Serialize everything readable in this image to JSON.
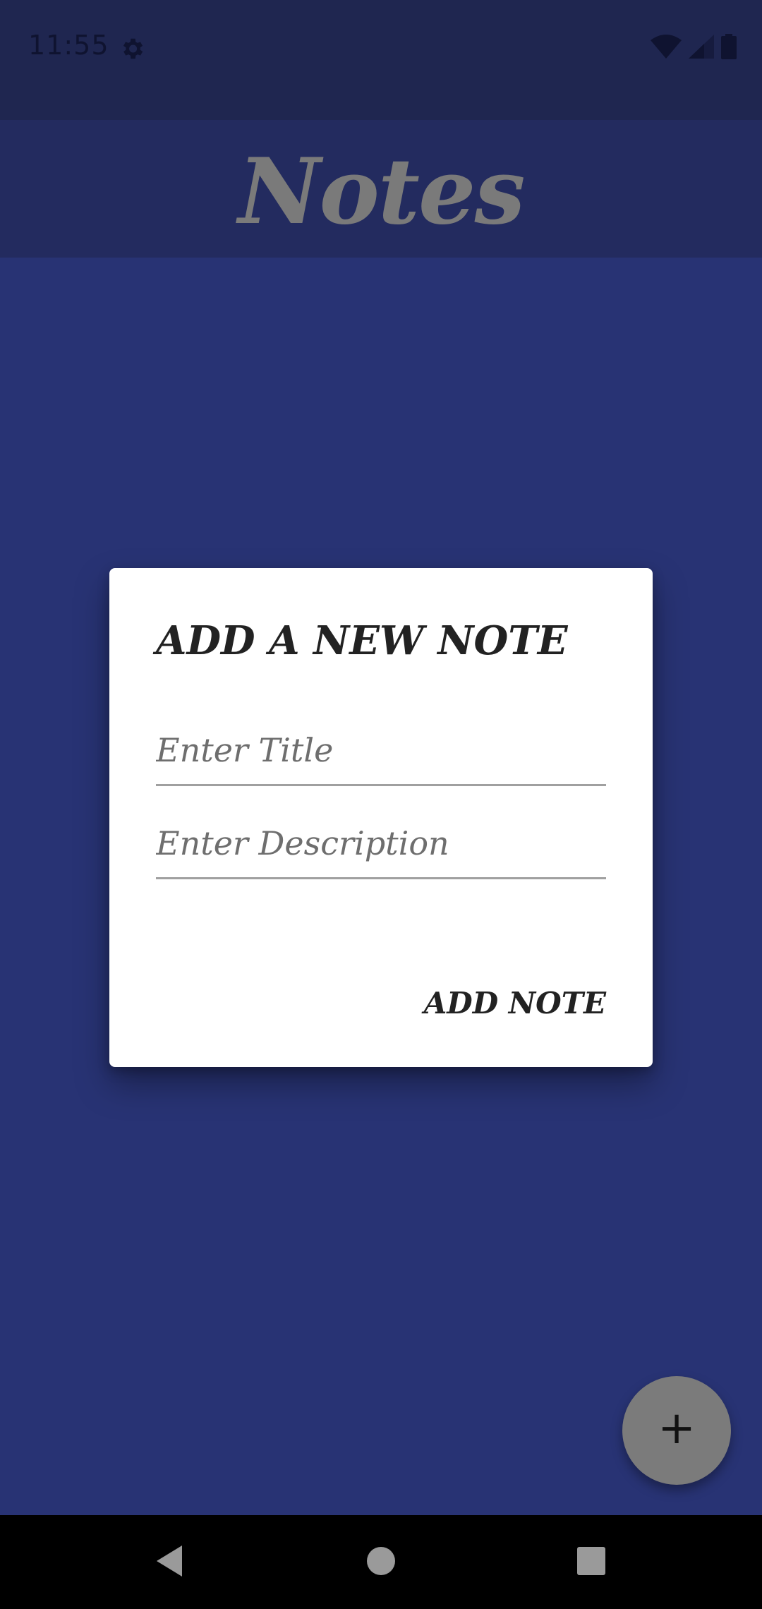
{
  "status_bar": {
    "time": "11:55",
    "icons": [
      "gear-icon",
      "wifi-icon",
      "signal-icon",
      "battery-icon"
    ]
  },
  "app_bar": {
    "title": "Notes"
  },
  "dialog": {
    "title": "ADD A NEW NOTE",
    "title_field": {
      "placeholder": "Enter Title",
      "value": ""
    },
    "description_field": {
      "placeholder": "Enter Description",
      "value": ""
    },
    "action_label": "ADD NOTE"
  },
  "fab": {
    "icon": "plus-icon",
    "glyph": "+"
  },
  "nav_bar": {
    "icons": [
      "back-icon",
      "home-icon",
      "recents-icon"
    ]
  },
  "colors": {
    "background": "#283374",
    "app_bar": "#232b5f",
    "status_bar": "#1f2650",
    "dialog": "#ffffff",
    "fab": "#7b7b7b",
    "nav_bar": "#000000"
  }
}
